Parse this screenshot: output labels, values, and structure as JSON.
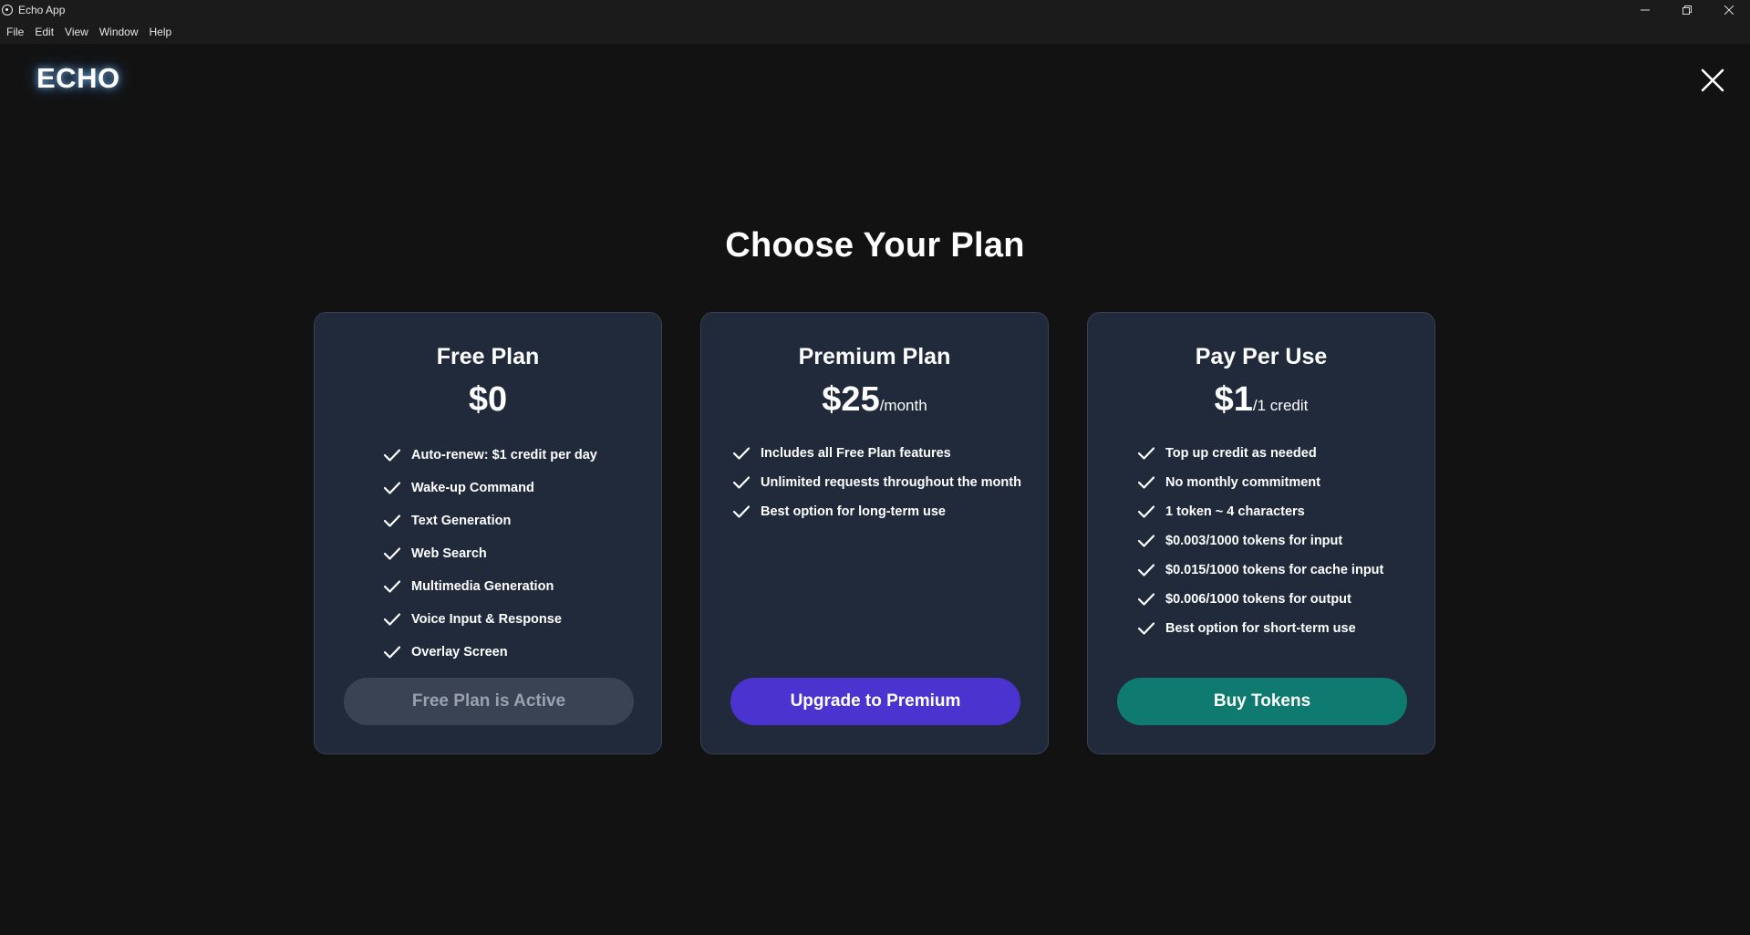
{
  "window": {
    "title": "Echo App",
    "app_icon": "app-circle-icon",
    "controls": {
      "minimize": "—",
      "maximize": "❐",
      "close": "✕"
    }
  },
  "menu": [
    "File",
    "Edit",
    "View",
    "Window",
    "Help"
  ],
  "logo": "ECHO",
  "page_title": "Choose Your Plan",
  "plans": [
    {
      "name": "Free Plan",
      "price": "$0",
      "unit": "",
      "features": [
        "Auto-renew: $1 credit per day",
        "Wake-up Command",
        "Text Generation",
        "Web Search",
        "Multimedia Generation",
        "Voice Input & Response",
        "Overlay Screen"
      ],
      "button": "Free Plan is Active",
      "button_color": "#3a4354"
    },
    {
      "name": "Premium Plan",
      "price": "$25",
      "unit": "/month",
      "features": [
        "Includes all Free Plan features",
        "Unlimited requests throughout the month",
        "Best option for long-term use"
      ],
      "button": "Upgrade to Premium",
      "button_color": "#4a33cf"
    },
    {
      "name": "Pay Per Use",
      "price": "$1",
      "unit": "/1 credit",
      "features": [
        "Top up credit as needed",
        "No monthly commitment",
        "1 token ~ 4 characters",
        "$0.003/1000 tokens for input",
        "$0.015/1000 tokens for cache input",
        "$0.006/1000 tokens for output",
        "Best option for short-term use"
      ],
      "button": "Buy Tokens",
      "button_color": "#0f7a6f"
    }
  ],
  "colors": {
    "background": "#121212",
    "card": "#212a3b",
    "card_border": "#364257"
  }
}
